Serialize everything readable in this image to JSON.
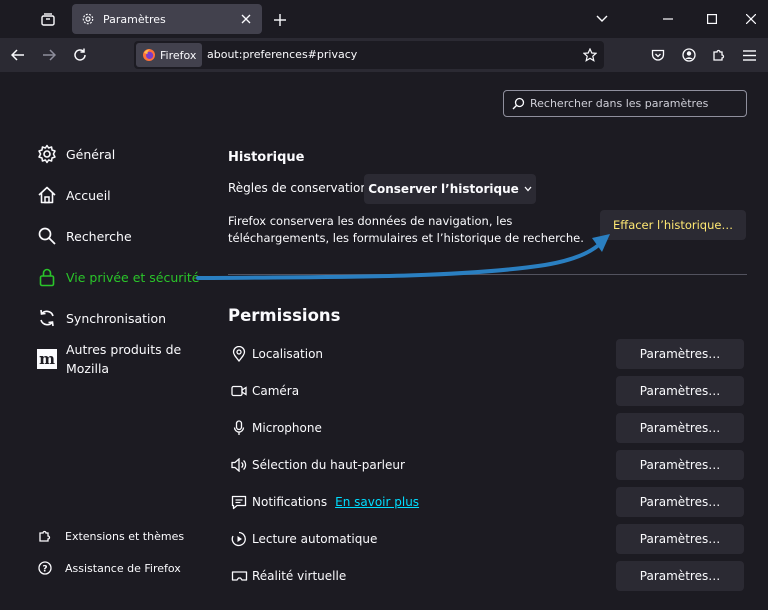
{
  "tab": {
    "title": "Paramètres"
  },
  "urlbar": {
    "identity": "Firefox",
    "url": "about:preferences#privacy"
  },
  "search": {
    "placeholder": "Rechercher dans les paramètres"
  },
  "sidebar": {
    "items": [
      {
        "label": "Général"
      },
      {
        "label": "Accueil"
      },
      {
        "label": "Recherche"
      },
      {
        "label": "Vie privée et sécurité"
      },
      {
        "label": "Synchronisation"
      },
      {
        "label": "Autres produits de Mozilla"
      }
    ],
    "footer": [
      {
        "label": "Extensions et thèmes"
      },
      {
        "label": "Assistance de Firefox"
      }
    ]
  },
  "history": {
    "heading": "Historique",
    "retention_label": "Règles de conservation",
    "retention_value": "Conserver l’historique",
    "description": "Firefox conservera les données de navigation, les téléchargements, les formulaires et l’historique de recherche.",
    "clear_button": "Effacer l’historique…"
  },
  "permissions": {
    "heading": "Permissions",
    "settings_label": "Paramètres…",
    "learn_more": "En savoir plus",
    "rows": [
      {
        "label": "Localisation"
      },
      {
        "label": "Caméra"
      },
      {
        "label": "Microphone"
      },
      {
        "label": "Sélection du haut-parleur"
      },
      {
        "label": "Notifications"
      },
      {
        "label": "Lecture automatique"
      },
      {
        "label": "Réalité virtuelle"
      }
    ]
  },
  "colors": {
    "background": "#1c1b22",
    "toolbar": "#2b2a33",
    "active_green": "#2ac52a",
    "link": "#00ddff",
    "highlight_yellow": "#ffe873",
    "arrow_blue": "#2a7fc1"
  }
}
